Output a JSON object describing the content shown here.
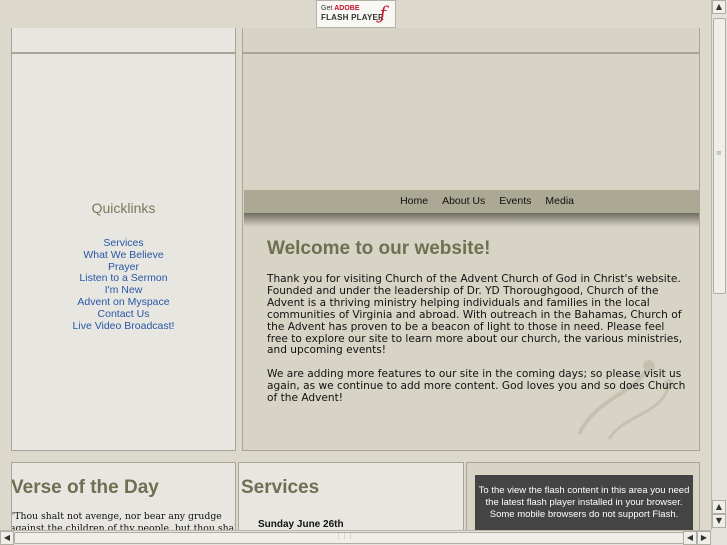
{
  "flash_badge": {
    "get": "Get",
    "adobe": "ADOBE",
    "player": "FLASH PLAYER"
  },
  "quicklinks": {
    "title": "Quicklinks",
    "items": [
      "Services",
      "What We Believe",
      "Prayer",
      "Listen to a Sermon",
      "I'm New",
      "Advent on Myspace",
      "Contact Us",
      "Live Video Broadcast!"
    ]
  },
  "nav": {
    "items": [
      "Home",
      "About Us",
      "Events",
      "Media"
    ]
  },
  "welcome": {
    "title": "Welcome to our website!",
    "paragraphs": [
      "Thank you for visiting Church of the Advent Church of God in Christ's website.  Founded and under the leadership of Dr. YD Thoroughgood, Church of the Advent is a thriving ministry helping individuals and families in the local communities of Virginia and abroad. With outreach in the Bahamas, Church of the Advent has proven to be a beacon of light to those in need. Please feel free to explore our site to learn more about our church, the various ministries, and upcoming events!",
      "We are adding more features to our site in the coming days; so please visit us again, as we continue to add more content. God loves you and so does Church of the Advent!"
    ]
  },
  "verse": {
    "title": "Verse of the Day",
    "lines": [
      "\"Thou shalt not avenge, nor bear any grudge",
      "against the children of thy people, but thou shalt love"
    ]
  },
  "services": {
    "title": "Services",
    "date": "Sunday June 26th"
  },
  "flash_notice": {
    "text": "To the view the flash content in this area you need the latest flash player installed in your browser. Some mobile browsers do not support Flash."
  },
  "colors": {
    "accent": "#6d7052",
    "link": "#2857a8",
    "nav_bar": "#aba894",
    "page_bg": "#dcd9cc"
  }
}
